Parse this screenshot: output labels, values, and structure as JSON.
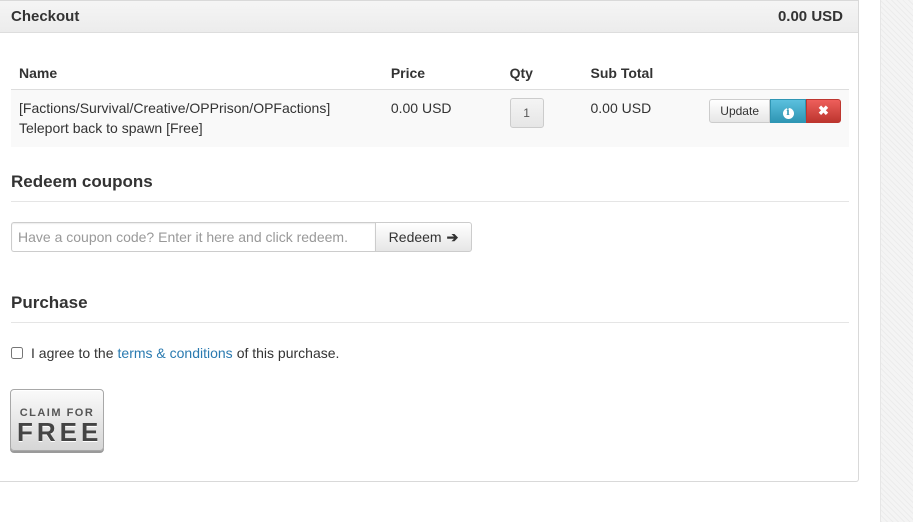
{
  "checkout": {
    "title": "Checkout",
    "total": "0.00 USD"
  },
  "table": {
    "headers": {
      "name": "Name",
      "price": "Price",
      "qty": "Qty",
      "subtotal": "Sub Total"
    },
    "rows": [
      {
        "name_line1": "[Factions/Survival/Creative/OPPrison/OPFactions]",
        "name_line2": "Teleport back to spawn [Free]",
        "price": "0.00 USD",
        "qty": "1",
        "subtotal": "0.00 USD",
        "update_label": "Update"
      }
    ]
  },
  "coupons": {
    "title": "Redeem coupons",
    "placeholder": "Have a coupon code? Enter it here and click redeem.",
    "redeem_label": "Redeem"
  },
  "purchase": {
    "title": "Purchase",
    "agree_prefix": "I agree to the",
    "terms_link": "terms & conditions",
    "agree_suffix": "of this purchase.",
    "claim_small": "CLAIM FOR",
    "claim_big": "FREE"
  },
  "colors": {
    "link": "#2a7ab0",
    "info_button": "#5bc0de",
    "danger_button": "#ee5f5b"
  },
  "icons": {
    "info": "info-icon",
    "remove": "remove-icon",
    "arrow": "arrow-right-icon"
  }
}
